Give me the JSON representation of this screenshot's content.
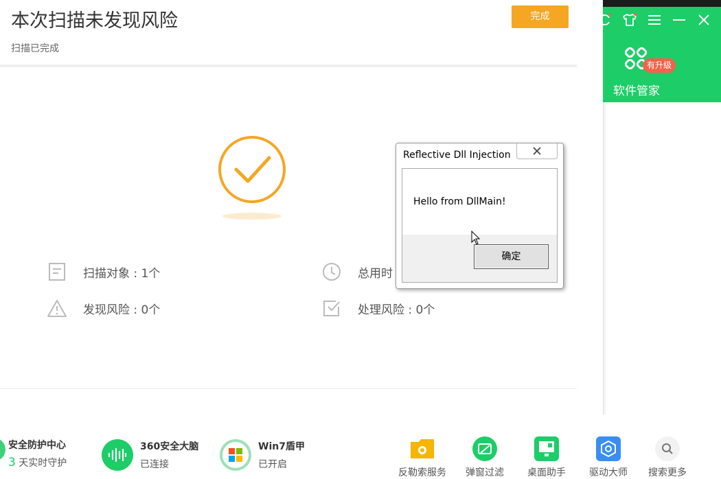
{
  "scan": {
    "title": "本次扫描未发现风险",
    "subtitle": "扫描已完成",
    "done_label": "完成"
  },
  "stats": {
    "scan_objects": "扫描对象 : 1个",
    "total_time": "总用时",
    "risks_found": "发现风险 : 0个",
    "risks_handled": "处理风险 : 0个"
  },
  "right_panel": {
    "software_manager_label": "软件管家",
    "upgrade_badge": "有升级"
  },
  "bottom": {
    "security_center": {
      "title": "安全防护中心",
      "days": "3",
      "sub": "天实时守护"
    },
    "brain": {
      "title": "360安全大脑",
      "sub": "已连接"
    },
    "win7": {
      "title": "Win7盾甲",
      "sub": "已开启"
    },
    "tools": [
      {
        "label": "反勒索服务",
        "icon": "folder-shield-icon"
      },
      {
        "label": "弹窗过滤",
        "icon": "popup-block-icon"
      },
      {
        "label": "桌面助手",
        "icon": "desktop-icon"
      },
      {
        "label": "驱动大师",
        "icon": "driver-icon"
      },
      {
        "label": "搜索更多",
        "icon": "search-icon"
      }
    ]
  },
  "dialog": {
    "title": "Reflective Dll Injection",
    "message": "Hello from DllMain!",
    "ok_label": "确定"
  },
  "colors": {
    "accent_orange": "#f5a623",
    "brand_green": "#1dcd67",
    "badge_red": "#f4624a"
  }
}
